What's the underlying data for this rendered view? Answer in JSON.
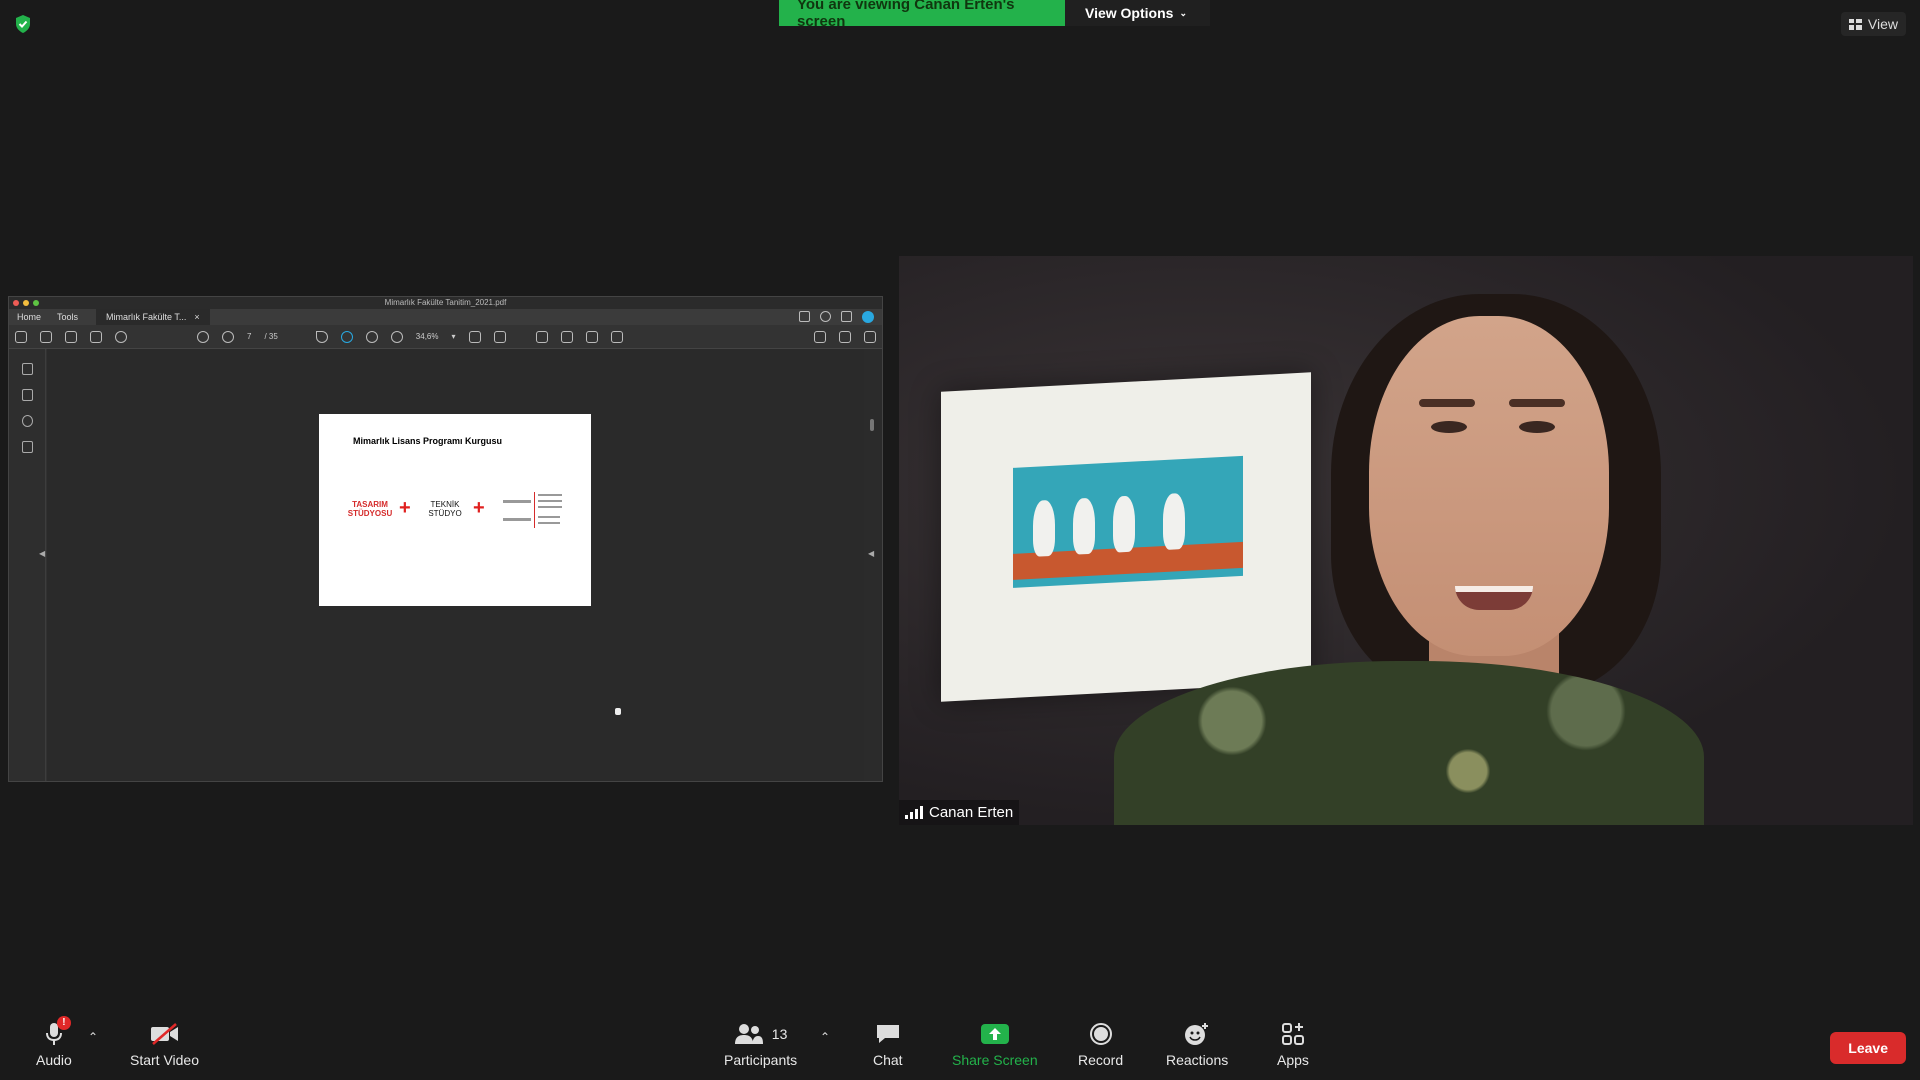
{
  "banner": {
    "viewing_text": "You are viewing Canan Erten's screen",
    "options_label": "View Options"
  },
  "view_button": {
    "label": "View"
  },
  "shared_app": {
    "window_title": "Mimarlık Fakülte Tanitim_2021.pdf",
    "menu_home": "Home",
    "menu_tools": "Tools",
    "doc_tab": "Mimarlık Fakülte T...",
    "doc_tab_close": "×",
    "page_current": "7",
    "page_total": "/ 35",
    "zoom": "34,6%",
    "page": {
      "title": "Mimarlık Lisans Programı Kurgusu",
      "studio1": "TASARIM STÜDYOSU",
      "studio2": "TEKNİK STÜDYO",
      "plus": "+"
    }
  },
  "participant": {
    "name": "Canan Erten"
  },
  "controls": {
    "audio": "Audio",
    "audio_badge": "!",
    "start_video": "Start Video",
    "participants": "Participants",
    "participants_count": "13",
    "chat": "Chat",
    "share_screen": "Share Screen",
    "record": "Record",
    "reactions": "Reactions",
    "apps": "Apps",
    "leave": "Leave"
  },
  "colors": {
    "banner_green": "#23b24b",
    "share_green": "#23b24b",
    "leave_red": "#d92b2b",
    "page_red": "#d52b2b"
  }
}
